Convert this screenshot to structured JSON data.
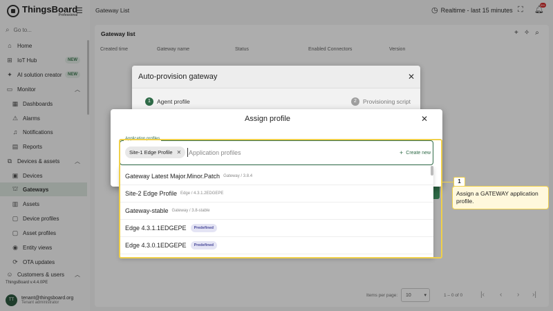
{
  "brand": {
    "name": "ThingsBoard",
    "edition": "Professional"
  },
  "search": {
    "label": "Go to..."
  },
  "sidebar": {
    "items": [
      {
        "label": "Home",
        "icon": "home-icon"
      },
      {
        "label": "IoT Hub",
        "icon": "hub-icon",
        "badge": "NEW"
      },
      {
        "label": "AI solution creator",
        "icon": "sparkle-icon",
        "badge": "NEW"
      },
      {
        "label": "Monitor",
        "icon": "monitor-icon"
      },
      {
        "label": "Dashboards",
        "icon": "dashboard-icon"
      },
      {
        "label": "Alarms",
        "icon": "alarm-icon"
      },
      {
        "label": "Notifications",
        "icon": "notification-icon"
      },
      {
        "label": "Reports",
        "icon": "report-icon"
      },
      {
        "label": "Devices & assets",
        "icon": "devices-assets-icon"
      },
      {
        "label": "Devices",
        "icon": "device-icon"
      },
      {
        "label": "Gateways",
        "icon": "gateway-icon"
      },
      {
        "label": "Assets",
        "icon": "asset-icon"
      },
      {
        "label": "Device profiles",
        "icon": "device-profile-icon"
      },
      {
        "label": "Asset profiles",
        "icon": "asset-profile-icon"
      },
      {
        "label": "Entity views",
        "icon": "entity-view-icon"
      },
      {
        "label": "OTA updates",
        "icon": "ota-icon"
      },
      {
        "label": "Customers & users",
        "icon": "customers-icon"
      }
    ],
    "version": "ThingsBoard v.4.4.0PE",
    "user": {
      "initials": "TT",
      "email": "tenant@thingsboard.org",
      "role": "Tenant administrator"
    }
  },
  "header": {
    "title": "Gateway List",
    "realtime": "Realtime - last 15 minutes",
    "notification_count": "99+"
  },
  "table": {
    "title": "Gateway list",
    "columns": [
      "Created time",
      "Gateway name",
      "Status",
      "Enabled Connectors",
      "Version"
    ],
    "items_per_page_label": "Items per page:",
    "page_size": "10",
    "range": "1 – 0 of 0"
  },
  "auto_provision": {
    "title": "Auto-provision gateway",
    "steps": [
      {
        "num": "1",
        "label": "Agent profile"
      },
      {
        "num": "2",
        "label": "Provisioning script"
      }
    ]
  },
  "assign_profile": {
    "title": "Assign profile",
    "field_label": "Application profiles",
    "chip": "Site-1 Edge Profile",
    "placeholder": "Application profiles",
    "create_new": "Create new",
    "options": [
      {
        "name": "Gateway Latest Major.Minor.Patch",
        "sub": "Gateway / 3.8.4"
      },
      {
        "name": "Site-2 Edge Profile",
        "sub": "Edge / 4.3.1.2EDGEPE"
      },
      {
        "name": "Gateway-stable",
        "sub": "Gateway / 3.8-stable"
      },
      {
        "name": "Edge 4.3.1.1EDGEPE",
        "badge": "Predefined"
      },
      {
        "name": "Edge 4.3.0.1EDGEPE",
        "badge": "Predefined"
      }
    ]
  },
  "callout": {
    "num": "1",
    "text": "Assign a GATEWAY application profile."
  }
}
